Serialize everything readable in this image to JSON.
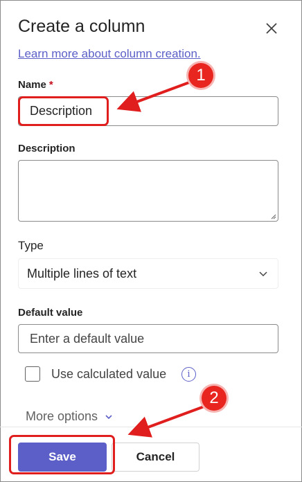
{
  "panel": {
    "title": "Create a column",
    "learn_more": "Learn more about column creation."
  },
  "name_field": {
    "label": "Name",
    "required_mark": "*",
    "value": "Description"
  },
  "description_field": {
    "label": "Description",
    "value": ""
  },
  "type_field": {
    "label": "Type",
    "selected": "Multiple lines of text"
  },
  "default_value_field": {
    "label": "Default value",
    "placeholder": "Enter a default value"
  },
  "calculated": {
    "label": "Use calculated value",
    "checked": false,
    "info_glyph": "i"
  },
  "more_options": {
    "label": "More options"
  },
  "footer": {
    "save_label": "Save",
    "cancel_label": "Cancel"
  },
  "annotations": [
    {
      "number": "1",
      "target": "name-input"
    },
    {
      "number": "2",
      "target": "save-button"
    }
  ],
  "colors": {
    "accent": "#5b5fc7",
    "annotation": "#e01e1e"
  }
}
